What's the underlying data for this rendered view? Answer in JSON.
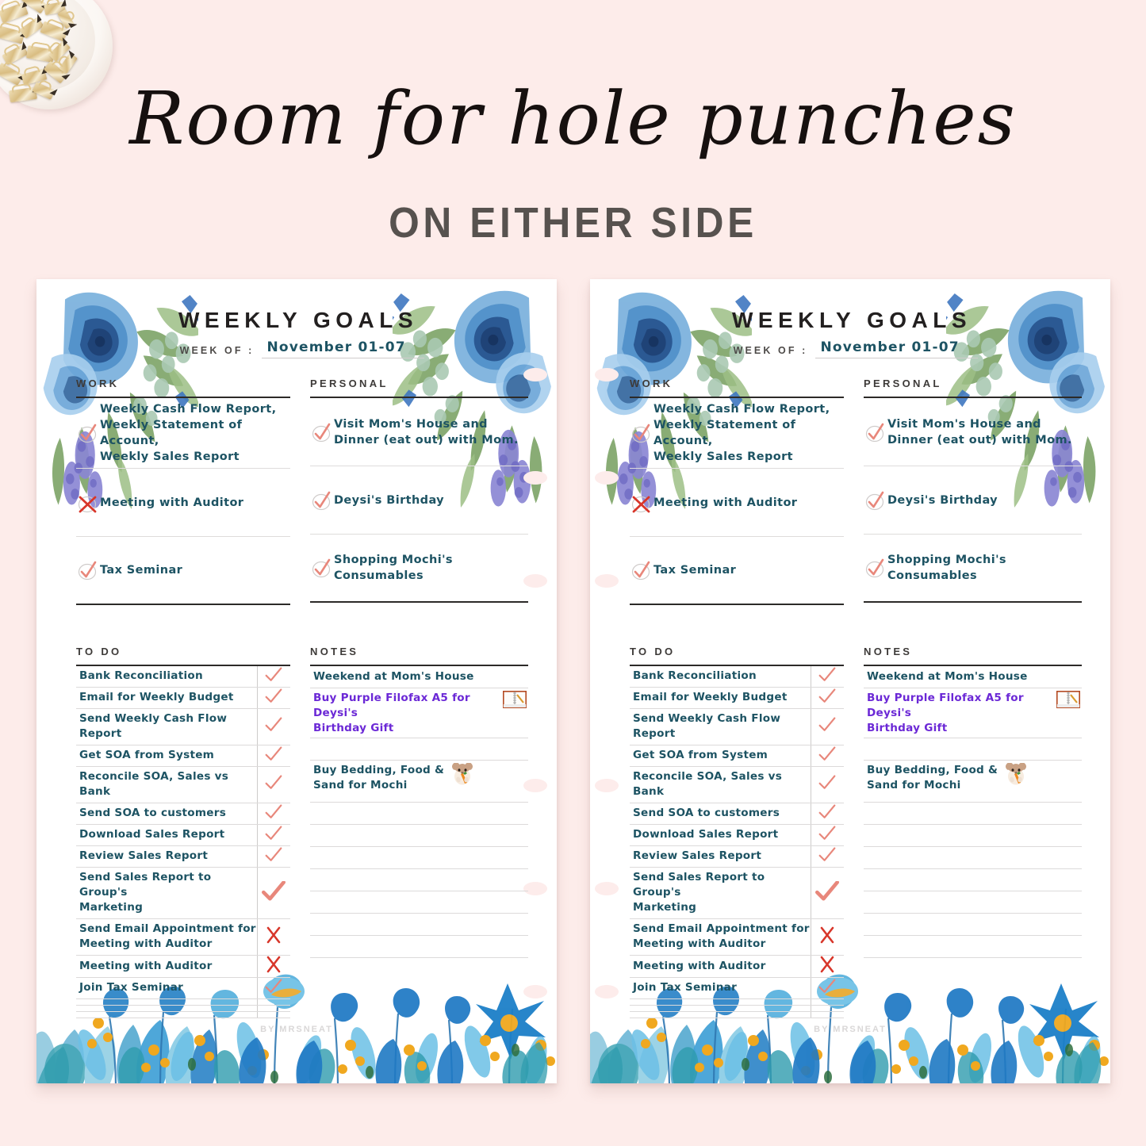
{
  "background_color": "#fdecea",
  "headline": {
    "script_line": "Room for hole punches",
    "sub_line": "ON EITHER SIDE"
  },
  "decor": {
    "bowl_label": "bowl-of-gold-binder-clips"
  },
  "page": {
    "title": "WEEKLY GOALS",
    "week_of_label": "WEEK OF :",
    "week_of_value": "November 01-07",
    "watermark": "BY MRSNEAT",
    "accent_text_color": "#1d5363",
    "check_color": "#e8877b",
    "cross_color": "#d8362a",
    "purple_color": "#6b28d6",
    "sections": {
      "work": {
        "heading": "WORK",
        "items": [
          {
            "mark": "check",
            "text": "Weekly Cash Flow Report,\nWeekly Statement of Account,\nWeekly Sales Report"
          },
          {
            "mark": "cross",
            "text": "Meeting with Auditor"
          },
          {
            "mark": "check",
            "text": "Tax Seminar"
          }
        ]
      },
      "personal": {
        "heading": "PERSONAL",
        "items": [
          {
            "mark": "check",
            "text": "Visit Mom's House and\nDinner (eat out) with Mom."
          },
          {
            "mark": "check",
            "text": "Deysi's Birthday"
          },
          {
            "mark": "check",
            "text": "Shopping Mochi's\nConsumables"
          }
        ]
      },
      "todo": {
        "heading": "TO DO",
        "rows": [
          {
            "label": "Bank Reconciliation",
            "mark": "check"
          },
          {
            "label": "Email for Weekly Budget",
            "mark": "check"
          },
          {
            "label": "Send Weekly Cash Flow Report",
            "mark": "check"
          },
          {
            "label": "Get SOA from System",
            "mark": "check"
          },
          {
            "label": "Reconcile SOA, Sales vs Bank",
            "mark": "check"
          },
          {
            "label": "Send SOA to customers",
            "mark": "check"
          },
          {
            "label": "Download Sales Report",
            "mark": "check"
          },
          {
            "label": "Review Sales Report",
            "mark": "check"
          },
          {
            "label": "Send Sales Report to Group's\nMarketing",
            "mark": "check-big"
          },
          {
            "label": "Send Email Appointment for\nMeeting with Auditor",
            "mark": "cross"
          },
          {
            "label": "Meeting with Auditor",
            "mark": "cross"
          },
          {
            "label": "Join Tax Seminar",
            "mark": "check"
          },
          {
            "label": "",
            "mark": "none"
          },
          {
            "label": "",
            "mark": "none"
          },
          {
            "label": "",
            "mark": "none"
          }
        ]
      },
      "notes": {
        "heading": "NOTES",
        "lines": [
          {
            "text": "Weekend at Mom's House",
            "color": "teal",
            "icon": ""
          },
          {
            "text": "Buy Purple Filofax A5 for Deysi's\nBirthday Gift",
            "color": "purple",
            "icon": "notebook-icon"
          },
          {
            "text": "",
            "color": "teal",
            "icon": ""
          },
          {
            "text": "Buy Bedding, Food &\nSand for Mochi",
            "color": "teal",
            "icon": "hamster-icon"
          },
          {
            "text": "",
            "color": "teal",
            "icon": ""
          },
          {
            "text": "",
            "color": "teal",
            "icon": ""
          },
          {
            "text": "",
            "color": "teal",
            "icon": ""
          },
          {
            "text": "",
            "color": "teal",
            "icon": ""
          },
          {
            "text": "",
            "color": "teal",
            "icon": ""
          },
          {
            "text": "",
            "color": "teal",
            "icon": ""
          },
          {
            "text": "",
            "color": "teal",
            "icon": ""
          }
        ]
      }
    }
  }
}
